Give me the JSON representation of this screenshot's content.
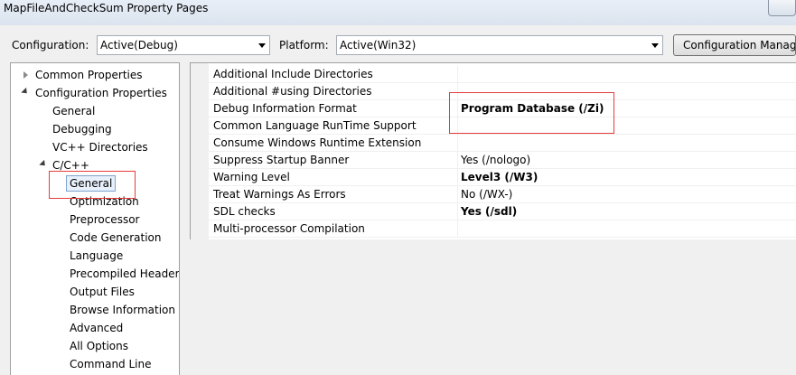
{
  "window": {
    "title": "MapFileAndCheckSum Property Pages"
  },
  "toolbar": {
    "configuration_label": "Configuration:",
    "configuration_value": "Active(Debug)",
    "platform_label": "Platform:",
    "platform_value": "Active(Win32)",
    "config_manager_label": "Configuration Manager..."
  },
  "tree": {
    "common_properties": "Common Properties",
    "configuration_properties": "Configuration Properties",
    "general": "General",
    "debugging": "Debugging",
    "vc_directories": "VC++ Directories",
    "c_cpp": "C/C++",
    "c_children": [
      "General",
      "Optimization",
      "Preprocessor",
      "Code Generation",
      "Language",
      "Precompiled Header",
      "Output Files",
      "Browse Information",
      "Advanced",
      "All Options",
      "Command Line"
    ]
  },
  "properties": [
    {
      "name": "Additional Include Directories",
      "value": ""
    },
    {
      "name": "Additional #using Directories",
      "value": ""
    },
    {
      "name": "Debug Information Format",
      "value": "Program Database (/Zi)"
    },
    {
      "name": "Common Language RunTime Support",
      "value": ""
    },
    {
      "name": "Consume Windows Runtime Extension",
      "value": ""
    },
    {
      "name": "Suppress Startup Banner",
      "value": "Yes (/nologo)"
    },
    {
      "name": "Warning Level",
      "value": "Level3 (/W3)"
    },
    {
      "name": "Treat Warnings As Errors",
      "value": "No (/WX-)"
    },
    {
      "name": "SDL checks",
      "value": "Yes (/sdl)"
    },
    {
      "name": "Multi-processor Compilation",
      "value": ""
    }
  ],
  "colors": {
    "annotation": "#e83b3b",
    "selection_border": "#7da2ce"
  }
}
